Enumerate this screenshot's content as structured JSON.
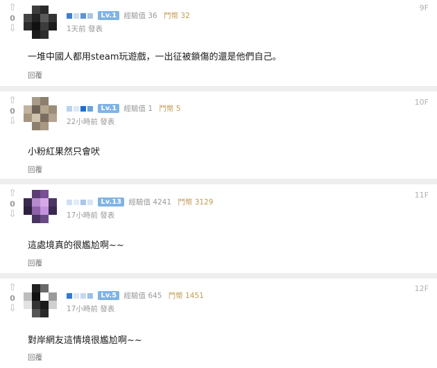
{
  "comments": [
    {
      "floor": "9F",
      "vote_count": "0",
      "level": "Lv.1",
      "exp": "經驗值 36",
      "coins": "鬥幣 32",
      "time": "1天前 發表",
      "text": "一堆中國人都用steam玩遊戲，一出征被鎖傷的還是他們自己。",
      "reply_label": "回覆",
      "accent": "#4a90d9"
    },
    {
      "floor": "10F",
      "vote_count": "0",
      "level": "Lv.1",
      "exp": "經驗值 1",
      "coins": "鬥幣 5",
      "time": "22小時前 發表",
      "text": "小粉紅果然只會吠",
      "reply_label": "回覆",
      "accent": "#4a90d9"
    },
    {
      "floor": "11F",
      "vote_count": "0",
      "level": "Lv.13",
      "exp": "經驗值 4241",
      "coins": "鬥幣 3129",
      "time": "17小時前 發表",
      "text": "這處境真的很尷尬啊~~",
      "reply_label": "回覆",
      "accent": "#7fb3e6"
    },
    {
      "floor": "12F",
      "vote_count": "0",
      "level": "Lv.5",
      "exp": "經驗值 645",
      "coins": "鬥幣 1451",
      "time": "17小時前 發表",
      "text": "對岸網友這情境很尷尬啊~~",
      "reply_label": "回覆",
      "accent": "#4a90d9"
    }
  ],
  "icons": {
    "upvote": "upvote-arrow-icon",
    "downvote": "downvote-arrow-icon"
  },
  "colors": {
    "level_badge": "#7fb3e6",
    "coin_text": "#c19a52",
    "separator": "#eeeeee"
  }
}
